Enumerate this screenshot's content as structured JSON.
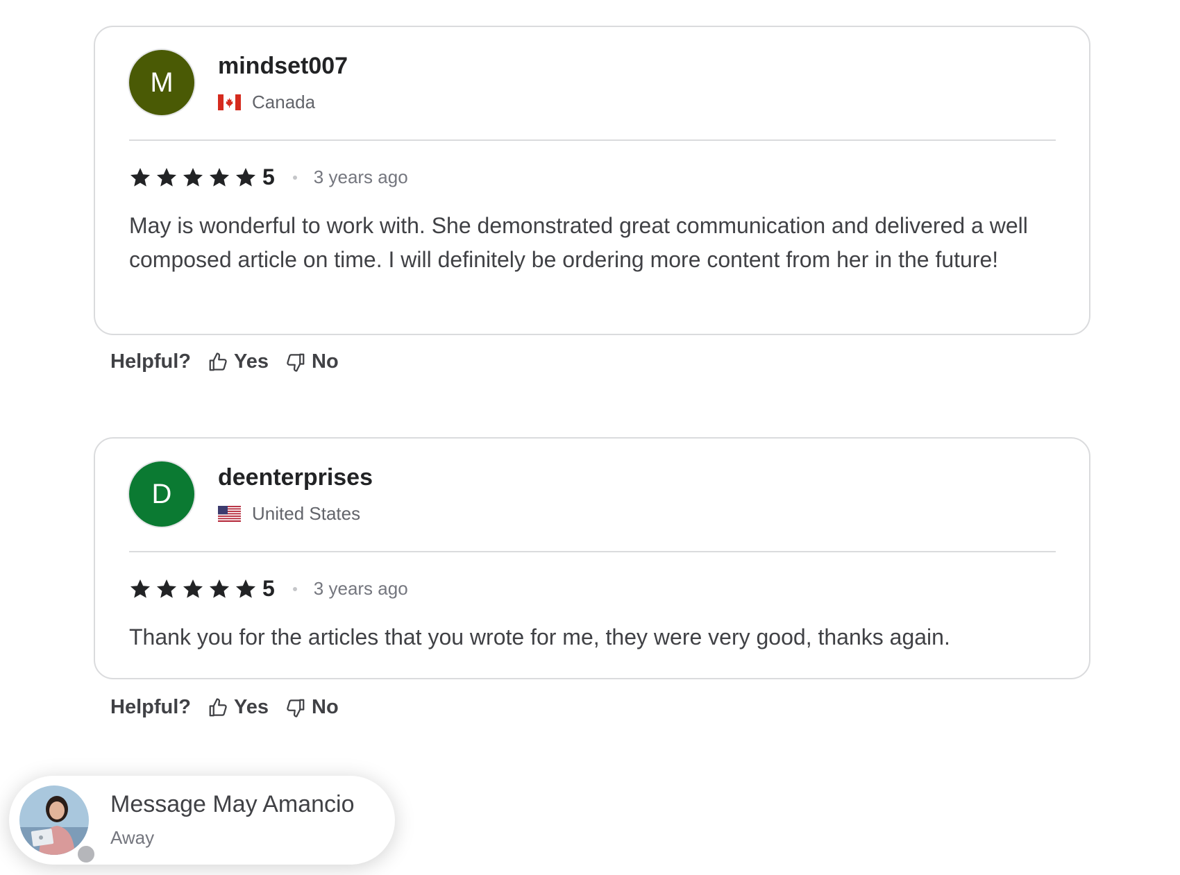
{
  "reviews": [
    {
      "avatar_letter": "M",
      "username": "mindset007",
      "country": "Canada",
      "flag_icon": "canada-flag-icon",
      "score": "5",
      "time": "3 years ago",
      "text": "May is wonderful to work with. She demonstrated great communication and delivered a well composed article on time. I will definitely be ordering more content from her in the future!",
      "avatar_color": "#4a5a05"
    },
    {
      "avatar_letter": "D",
      "username": "deenterprises",
      "country": "United States",
      "flag_icon": "united-states-flag-icon",
      "score": "5",
      "time": "3 years ago",
      "text": "Thank you for the articles that you wrote for me, they were very good, thanks again.",
      "avatar_color": "#0b7a32"
    }
  ],
  "helpful": {
    "label": "Helpful?",
    "yes_label": "Yes",
    "no_label": "No"
  },
  "chat": {
    "title": "Message May Amancio",
    "status": "Away"
  }
}
